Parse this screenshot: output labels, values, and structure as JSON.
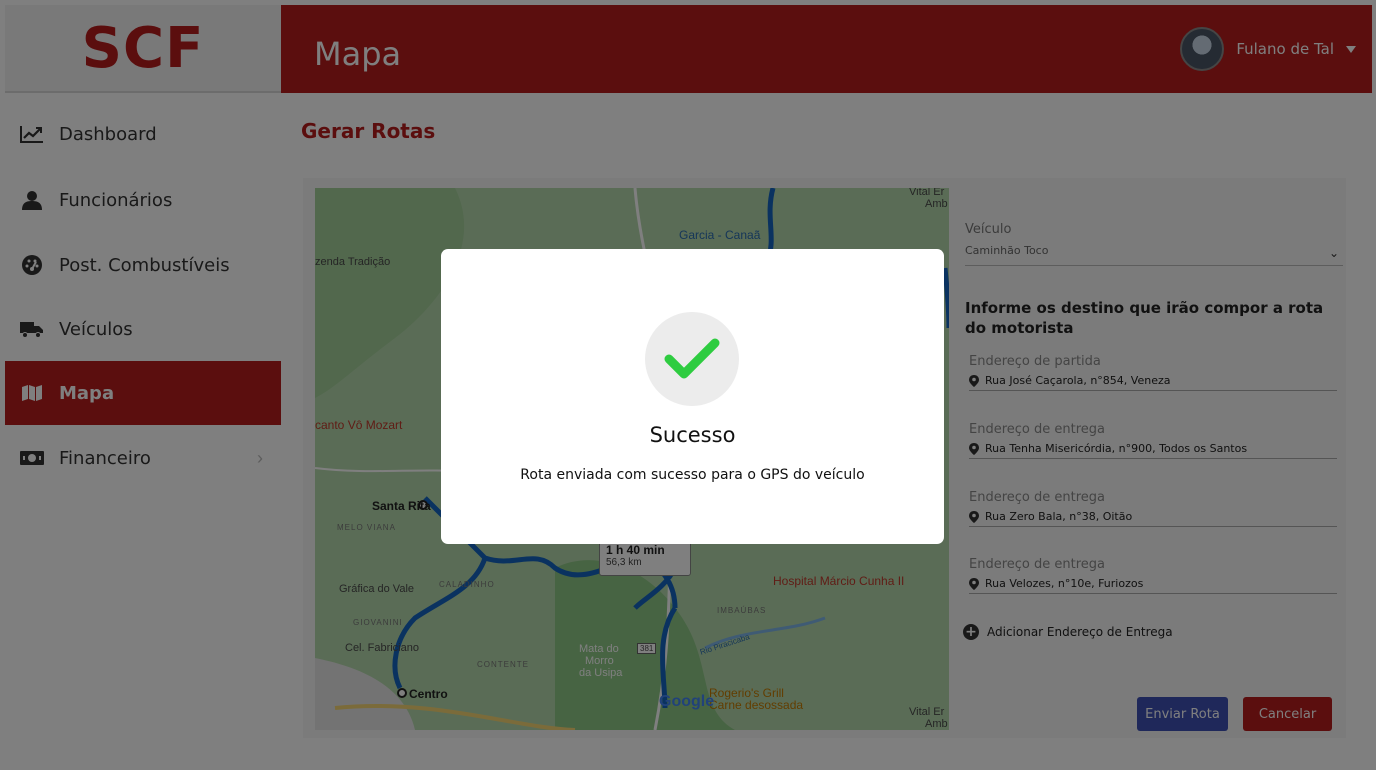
{
  "app": {
    "logo": "SCF"
  },
  "header": {
    "title": "Mapa",
    "user_name": "Fulano de Tal"
  },
  "sidebar": {
    "items": [
      {
        "label": "Dashboard",
        "icon": "chart-line-icon"
      },
      {
        "label": "Funcionários",
        "icon": "user-icon"
      },
      {
        "label": "Post. Combustíveis",
        "icon": "gauge-icon"
      },
      {
        "label": "Veículos",
        "icon": "truck-icon"
      },
      {
        "label": "Mapa",
        "icon": "map-icon",
        "active": true
      },
      {
        "label": "Financeiro",
        "icon": "money-icon",
        "has_submenu": true
      }
    ]
  },
  "page": {
    "title": "Gerar Rotas"
  },
  "map": {
    "labels": {
      "vital1": "Vital Er",
      "amb1": "Amb",
      "garcia": "Garcia - Canaã",
      "fazenda": "zenda Tradição",
      "canto": "canto Vô Mozart",
      "santa_rita": "Santa Rita",
      "melo_viana": "MELO VIANA",
      "grafica": "Gráfica do Vale",
      "calandinho": "CALADINHO",
      "giovanini": "GIOVANINI",
      "fabriciano": "Cel. Fabriciano",
      "contente": "CONTENTE",
      "centro": "Centro",
      "mata1": "Mata do",
      "mata2": "Morro",
      "mata3": "da Usipa",
      "hospital": "Hospital Márcio Cunha II",
      "imbaubas": "IMBAÚBAS",
      "rio": "Rio Piracicaba",
      "rogerio": "Rogerio's Grill",
      "desossada": "Carne desossada",
      "vital2": "Vital Er",
      "amb2": "Amb",
      "road": "381",
      "google": "Google"
    },
    "route": {
      "time": "1 h 40 min",
      "distance": "56,3 km"
    }
  },
  "form": {
    "vehicle_label": "Veículo",
    "vehicle_value": "Caminhão Toco",
    "destinations_title": "Informe os destino que irão compor a rota do motorista",
    "addresses": [
      {
        "label": "Endereço de partida",
        "value": "Rua José Caçarola, n°854, Veneza"
      },
      {
        "label": "Endereço de entrega",
        "value": "Rua Tenha Misericórdia, n°900, Todos os Santos"
      },
      {
        "label": "Endereço de entrega",
        "value": "Rua Zero Bala, n°38, Oitão"
      },
      {
        "label": "Endereço de entrega",
        "value": "Rua Velozes, n°10e, Furiozos"
      }
    ],
    "add_label": "Adicionar Endereço de Entrega",
    "send_label": "Enviar Rota",
    "cancel_label": "Cancelar"
  },
  "modal": {
    "title": "Sucesso",
    "message": "Rota enviada com sucesso para o GPS do veículo",
    "icon": "checkmark-icon",
    "check_color": "#2ecc40"
  },
  "colors": {
    "brand": "#b71c1c",
    "primary": "#3f51b5",
    "route": "#1a73e8"
  }
}
